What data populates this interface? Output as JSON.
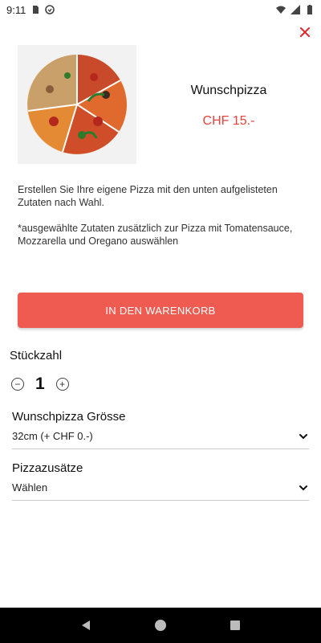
{
  "status_bar": {
    "time": "9:11",
    "icons_left": [
      "sd-card-icon",
      "sync-icon"
    ],
    "icons_right": [
      "wifi-icon",
      "signal-icon",
      "battery-icon"
    ]
  },
  "product": {
    "title": "Wunschpizza",
    "price": "CHF 15.-",
    "image_icon": "pizza-image",
    "description_1": "Erstellen Sie Ihre eigene Pizza mit den unten aufgelisteten Zutaten nach Wahl.",
    "description_2": "*ausgewählte Zutaten zusätzlich zur Pizza mit Tomatensauce, Mozzarella und Oregano auswählen"
  },
  "actions": {
    "add_to_cart": "IN DEN WARENKORB"
  },
  "quantity": {
    "label": "Stückzahl",
    "value": "1",
    "decrement_symbol": "−",
    "increment_symbol": "+"
  },
  "options": [
    {
      "title": "Wunschpizza Grösse",
      "value": "32cm (+ CHF 0.-)"
    },
    {
      "title": "Pizzazusätze",
      "value": "Wählen"
    }
  ],
  "colors": {
    "accent": "#ef5b50",
    "price": "#e5433b",
    "close": "#e0252a"
  }
}
